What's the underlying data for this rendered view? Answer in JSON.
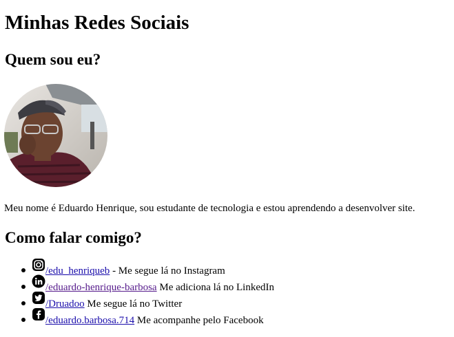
{
  "page": {
    "title": "Minhas Redes Sociais",
    "about_heading": "Quem sou eu?",
    "bio": "Meu nome é Eduardo Henrique, sou estudante de tecnologia e estou aprendendo a desenvolver site.",
    "contact_heading": "Como falar comigo?"
  },
  "contacts": [
    {
      "icon": "instagram-icon",
      "link": "/edu_henriqueb",
      "text": " - Me segue lá no Instagram"
    },
    {
      "icon": "linkedin-icon",
      "link": "/eduardo-henrique-barbosa",
      "text": " Me adiciona lá no LinkedIn"
    },
    {
      "icon": "twitter-icon",
      "link": "/Druadoo",
      "text": " Me segue lá no Twitter"
    },
    {
      "icon": "facebook-icon",
      "link": "/eduardo.barbosa.714",
      "text": " Me acompanhe pelo Facebook"
    }
  ],
  "colors": {
    "link": "#1a0dab",
    "visited_link": "#551a8b",
    "text": "#000000",
    "background": "#ffffff"
  }
}
